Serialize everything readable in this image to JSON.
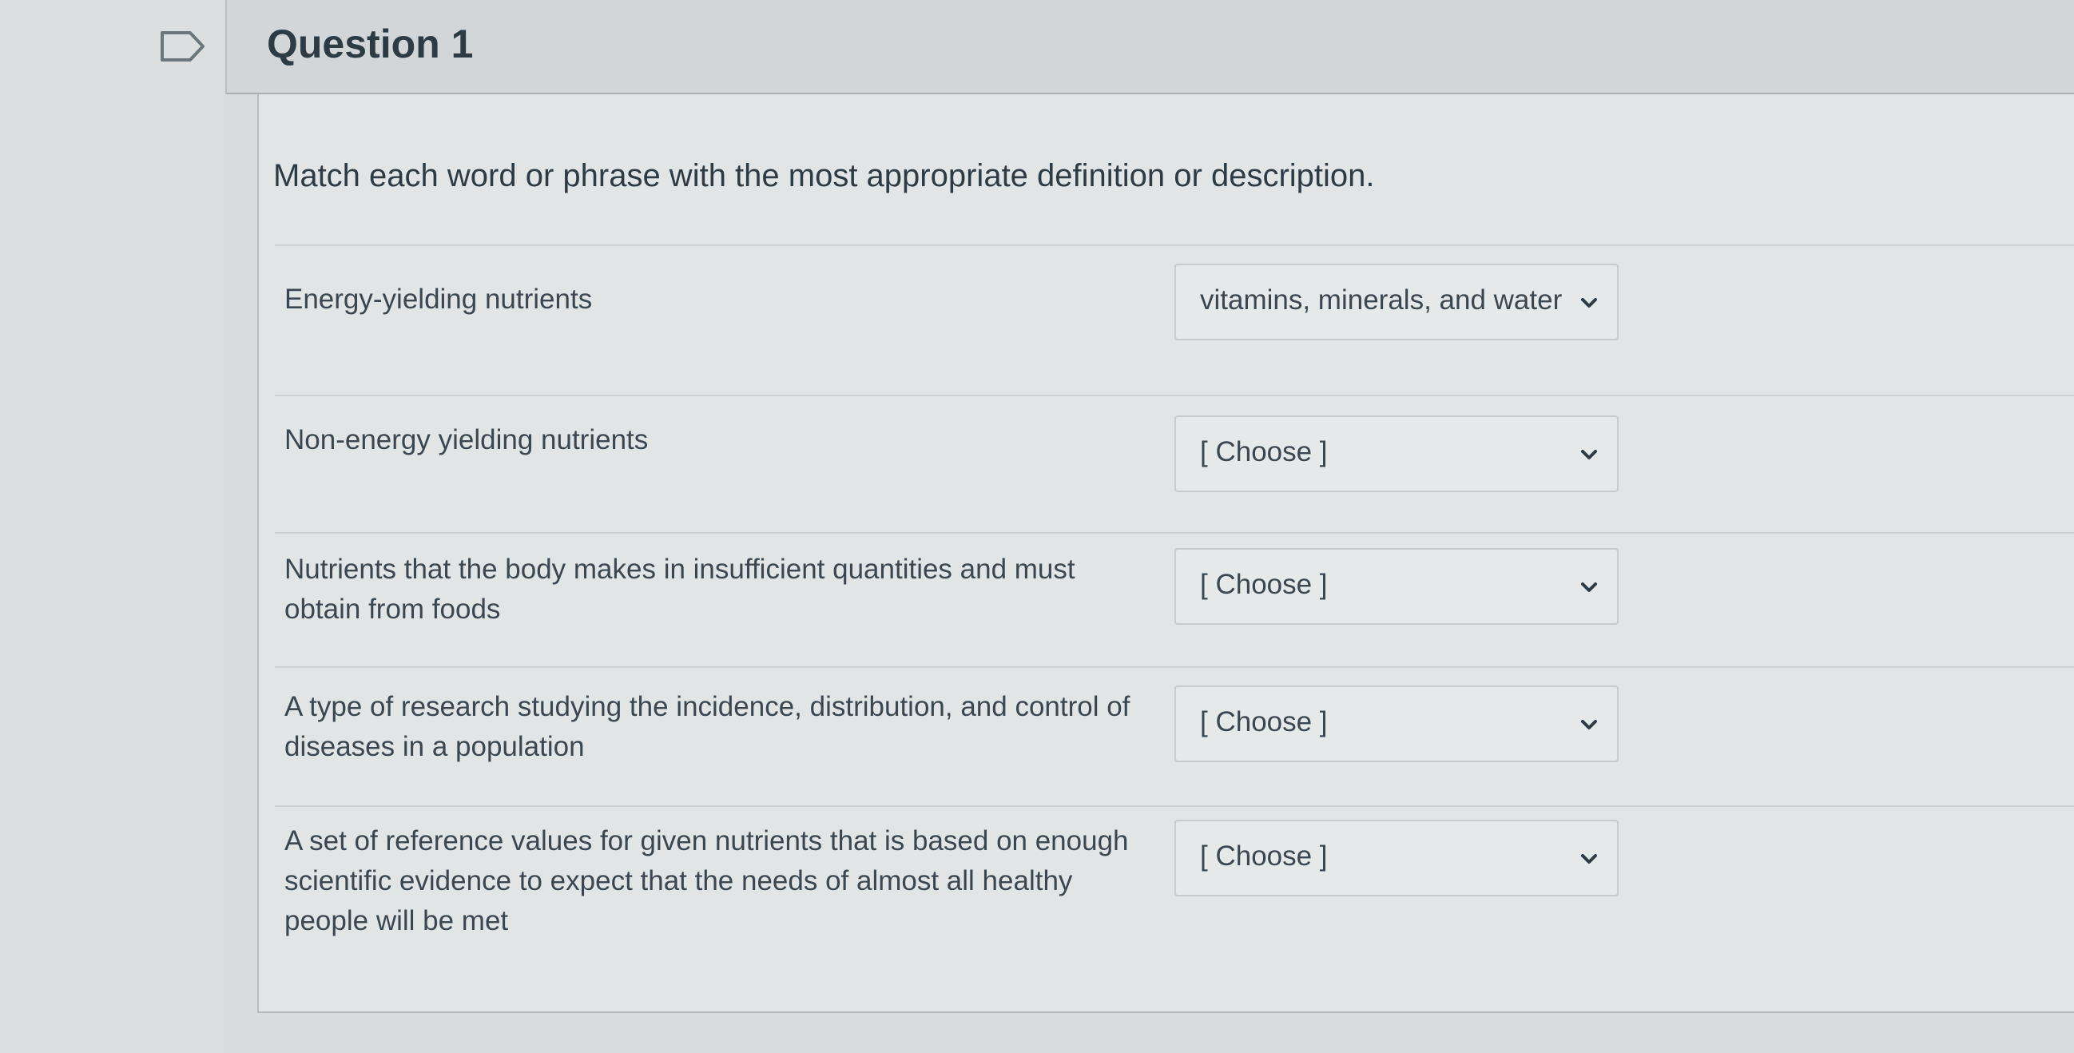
{
  "question": {
    "title": "Question 1",
    "prompt": "Match each word or phrase with the most appropriate definition or description."
  },
  "icons": {
    "flag": "flag-icon",
    "chevron": "chevron-down-icon"
  },
  "colors": {
    "text": "#2d3b45",
    "panel": "#e2e5e6",
    "header": "#d3d6d8"
  },
  "items": [
    {
      "term": "Energy-yielding nutrients",
      "selected": "vitamins, minerals, and water"
    },
    {
      "term": "Non-energy yielding nutrients",
      "selected": "[ Choose ]"
    },
    {
      "term": "Nutrients that the body makes in insufficient quantities and must obtain from foods",
      "selected": "[ Choose ]"
    },
    {
      "term": "A type of research studying the incidence, distribution, and control of diseases in a population",
      "selected": "[ Choose ]"
    },
    {
      "term": "A set of reference values for given nutrients that is based on enough scientific evidence to expect that the needs of almost all healthy people will be met",
      "selected": "[ Choose ]"
    }
  ]
}
